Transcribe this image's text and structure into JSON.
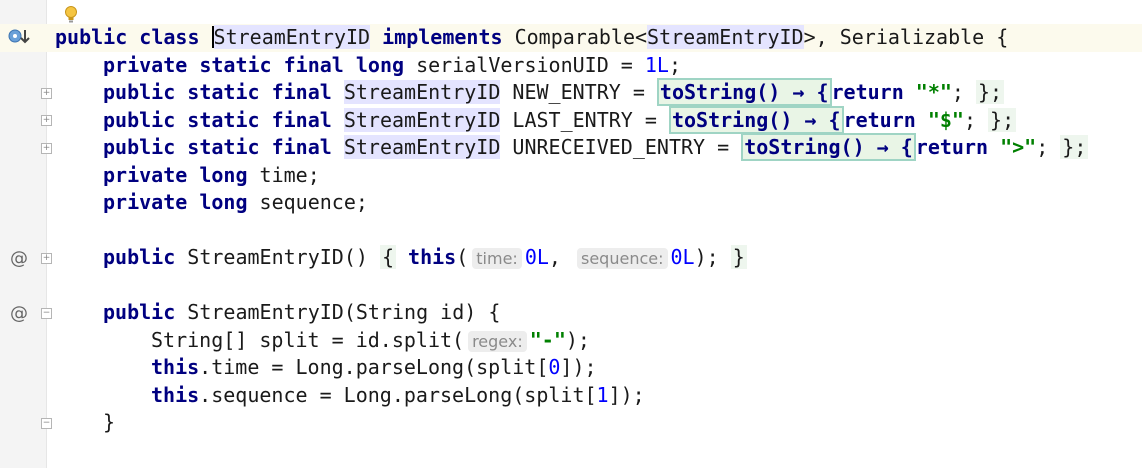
{
  "editor": {
    "lines": {
      "l1": {
        "a": "public class ",
        "b": "StreamEntryID",
        "c": " implements ",
        "d": "Comparable<",
        "e": "StreamEntryID",
        "f": ">, Serializable {"
      },
      "l2": {
        "a": "private static final long ",
        "b": "serialVersionUID = ",
        "c": "1L",
        "d": ";"
      },
      "l3": {
        "kw": "public static final ",
        "type": "StreamEntryID",
        "name": " NEW_ENTRY = ",
        "fold": "toString() → {",
        "ret": "return",
        "str": "\"*\"",
        "end": ";",
        "close": "};"
      },
      "l4": {
        "kw": "public static final ",
        "type": "StreamEntryID",
        "name": " LAST_ENTRY = ",
        "fold": "toString() → {",
        "ret": "return",
        "str": "\"$\"",
        "end": ";",
        "close": "};"
      },
      "l5": {
        "kw": "public static final ",
        "type": "StreamEntryID",
        "name": " UNRECEIVED_ENTRY = ",
        "fold": "toString() → {",
        "ret": "return",
        "str": "\">\"",
        "end": ";",
        "close": "};"
      },
      "l6": {
        "kw": "private long ",
        "rest": "time;"
      },
      "l7": {
        "kw": "private long ",
        "rest": "sequence;"
      },
      "l9": {
        "kw": "public ",
        "sig": "StreamEntryID() ",
        "open": "{",
        "this": "this",
        "paren": "(",
        "hint1": "time:",
        "v1": "0L",
        "comma": ",",
        "hint2": "sequence:",
        "v2": "0L",
        "end": ");",
        "close": "}"
      },
      "l11": {
        "kw": "public ",
        "sig": "StreamEntryID(String id) {"
      },
      "l12": {
        "a": "String[] split = id.split(",
        "hint": "regex:",
        "str": "\"-\"",
        "end": ");"
      },
      "l13": {
        "this": "this",
        "a": ".time = Long.parseLong(split[",
        "num": "0",
        "end": "]);"
      },
      "l14": {
        "this": "this",
        "a": ".sequence = Long.parseLong(split[",
        "num": "1",
        "end": "]);"
      },
      "l15": {
        "a": "}"
      }
    }
  },
  "gutter": {
    "override_icon": "implemented-interface-icon",
    "annotation_marker": "@"
  }
}
